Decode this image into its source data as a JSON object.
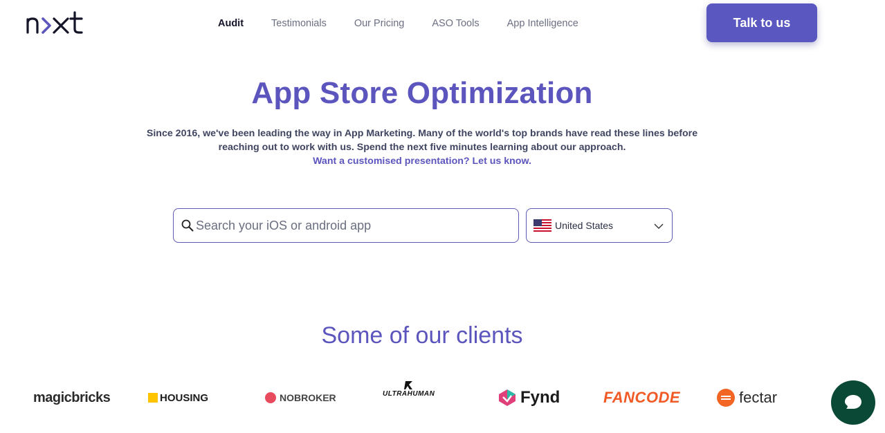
{
  "brand": {
    "logo_text": "nxt"
  },
  "nav": {
    "items": [
      {
        "label": "Audit",
        "active": true
      },
      {
        "label": "Testimonials",
        "active": false
      },
      {
        "label": "Our Pricing",
        "active": false
      },
      {
        "label": "ASO Tools",
        "active": false
      },
      {
        "label": "App Intelligence",
        "active": false
      }
    ]
  },
  "cta": {
    "label": "Talk to us"
  },
  "hero": {
    "title": "App Store Optimization",
    "subtitle_line1": "Since 2016, we've been leading the way in App Marketing. Many of the world's top brands have read these lines before",
    "subtitle_line2": "reaching out to work with us. Spend the next five minutes learning about our approach.",
    "link": "Want a customised presentation? Let us know."
  },
  "search": {
    "placeholder": "Search your iOS or android app",
    "value": ""
  },
  "country_select": {
    "selected": "United States",
    "flag_icon": "us-flag-icon"
  },
  "clients": {
    "title": "Some of our clients",
    "logos": [
      {
        "name": "magicbricks"
      },
      {
        "name": "HOUSING"
      },
      {
        "name": "NOBROKER"
      },
      {
        "name": "ULTRAHUMAN"
      },
      {
        "name": "Fynd"
      },
      {
        "name": "FANCODE"
      },
      {
        "name": "fectar"
      }
    ]
  },
  "colors": {
    "accent": "#5b55bd",
    "chat": "#0b4937",
    "cta": "#5a58c0"
  }
}
